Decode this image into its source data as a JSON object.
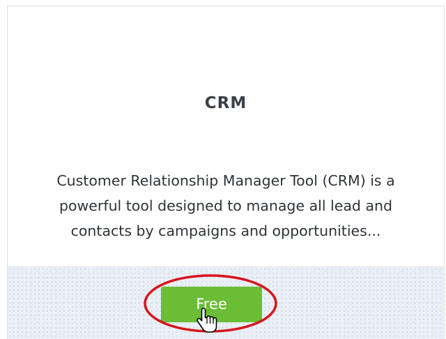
{
  "app": {
    "logo_text": "CRM",
    "description": "Customer Relationship Manager Tool (CRM) is a powerful tool designed to manage all lead and contacts by campaigns and opportunities...",
    "button_label": "Free"
  },
  "colors": {
    "button": "#6abd35",
    "highlight_ring": "#d6141b",
    "footer_bg": "#eaf0f6"
  },
  "icons": {
    "cursor": "hand-pointer-icon"
  }
}
